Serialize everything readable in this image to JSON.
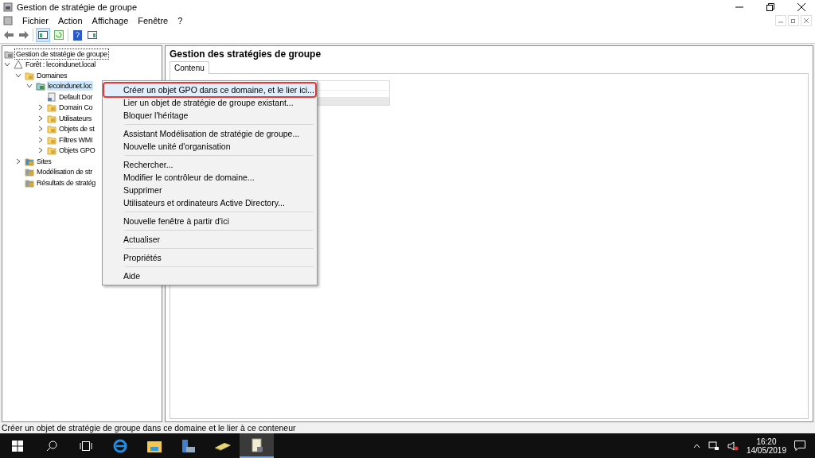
{
  "window": {
    "title": "Gestion de stratégie de groupe"
  },
  "menu_bar": [
    "Fichier",
    "Action",
    "Affichage",
    "Fenêtre",
    "?"
  ],
  "tree": [
    {
      "label": "Gestion de stratégie de groupe",
      "kind": "root",
      "selected": false,
      "children": [
        {
          "label": "Forêt : lecoindunet.local",
          "kind": "forest",
          "expanded": true,
          "selected": false,
          "children": [
            {
              "label": "Domaines",
              "kind": "folder",
              "expanded": true,
              "selected": false,
              "children": [
                {
                  "label": "lecoindunet.loc",
                  "kind": "domain",
                  "expanded": true,
                  "selected": true,
                  "children": [
                    {
                      "label": "Default Dor",
                      "kind": "gpo",
                      "selected": false
                    },
                    {
                      "label": "Domain Co",
                      "kind": "folder",
                      "expanded": false,
                      "selected": false
                    },
                    {
                      "label": "Utilisateurs",
                      "kind": "folder",
                      "expanded": false,
                      "selected": false
                    },
                    {
                      "label": "Objets de st",
                      "kind": "folder",
                      "expanded": false,
                      "selected": false
                    },
                    {
                      "label": "Filtres WMI",
                      "kind": "folder",
                      "expanded": false,
                      "selected": false
                    },
                    {
                      "label": "Objets GPO",
                      "kind": "folder",
                      "expanded": false,
                      "selected": false
                    }
                  ]
                }
              ]
            },
            {
              "label": "Sites",
              "kind": "sites",
              "expanded": false,
              "selected": false
            },
            {
              "label": "Modélisation de str",
              "kind": "report",
              "selected": false
            },
            {
              "label": "Résultats de stratég",
              "kind": "report",
              "selected": false
            }
          ]
        }
      ]
    }
  ],
  "content": {
    "title": "Gestion des stratégies de groupe",
    "tabs": [
      {
        "label": "Contenu",
        "selected": true
      }
    ]
  },
  "context_menu": [
    [
      {
        "label": "Créer un objet GPO dans ce domaine, et le lier ici...",
        "selected": true
      },
      {
        "label": "Lier un objet de stratégie de groupe existant...",
        "selected": false
      },
      {
        "label": "Bloquer l'héritage",
        "selected": false
      }
    ],
    [
      {
        "label": "Assistant Modélisation de stratégie de groupe...",
        "selected": false
      },
      {
        "label": "Nouvelle unité d'organisation",
        "selected": false
      }
    ],
    [
      {
        "label": "Rechercher...",
        "selected": false
      },
      {
        "label": "Modifier le contrôleur de domaine...",
        "selected": false
      },
      {
        "label": "Supprimer",
        "selected": false
      },
      {
        "label": "Utilisateurs et ordinateurs Active Directory...",
        "selected": false
      }
    ],
    [
      {
        "label": "Nouvelle fenêtre à partir d'ici",
        "selected": false
      }
    ],
    [
      {
        "label": "Actualiser",
        "selected": false
      }
    ],
    [
      {
        "label": "Propriétés",
        "selected": false
      }
    ],
    [
      {
        "label": "Aide",
        "selected": false
      }
    ]
  ],
  "status_bar": "Créer un objet de stratégie de groupe dans ce domaine et le lier à ce conteneur",
  "taskbar": {
    "time": "16:20",
    "date": "14/05/2019"
  }
}
